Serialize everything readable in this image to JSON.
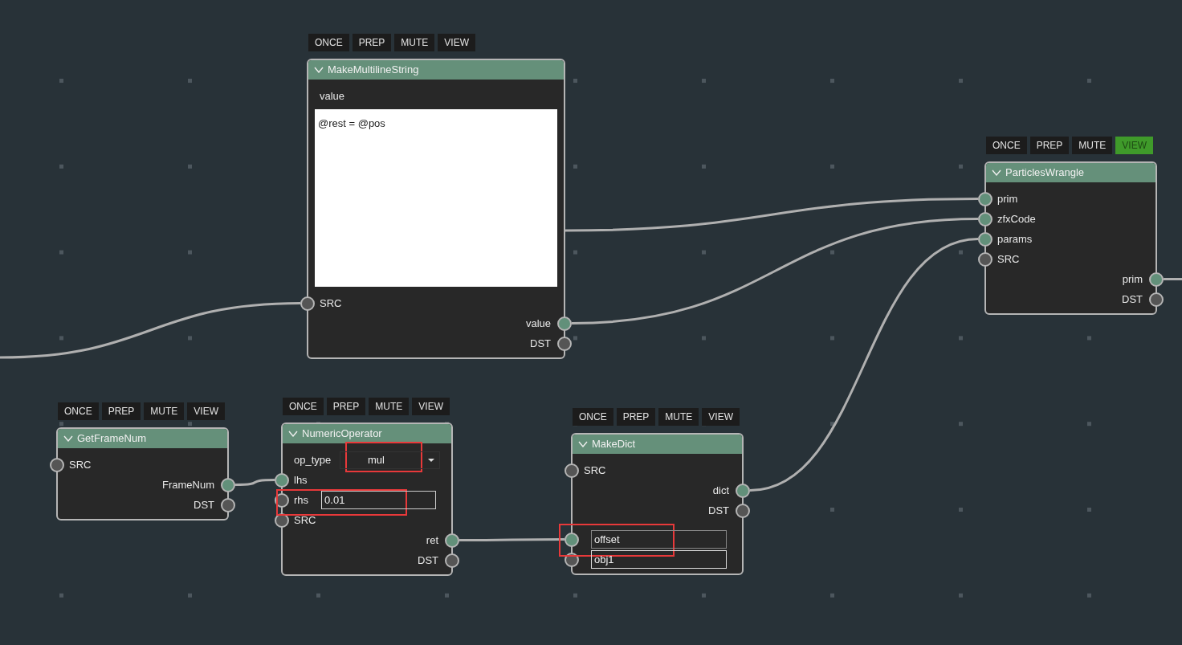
{
  "nodes": [
    {
      "title": "MakeMultilineString",
      "flags": [
        {
          "label": "ONCE",
          "on": false
        },
        {
          "label": "PREP",
          "on": false
        },
        {
          "label": "MUTE",
          "on": false
        },
        {
          "label": "VIEW",
          "on": false
        }
      ],
      "rows": [
        {
          "kind": "label",
          "label": "value"
        },
        {
          "kind": "textarea",
          "value": "@rest = @pos"
        },
        {
          "kind": "input",
          "label": "SRC",
          "color": "#555555"
        },
        {
          "kind": "output",
          "label": "value",
          "color": "#62907a"
        },
        {
          "kind": "output",
          "label": "DST",
          "color": "#555555"
        }
      ]
    },
    {
      "title": "ParticlesWrangle",
      "flags": [
        {
          "label": "ONCE",
          "on": false
        },
        {
          "label": "PREP",
          "on": false
        },
        {
          "label": "MUTE",
          "on": false
        },
        {
          "label": "VIEW",
          "on": true
        }
      ],
      "rows": [
        {
          "kind": "input",
          "label": "prim",
          "color": "#62907a"
        },
        {
          "kind": "input",
          "label": "zfxCode",
          "color": "#62907a"
        },
        {
          "kind": "input",
          "label": "params",
          "color": "#62907a"
        },
        {
          "kind": "input",
          "label": "SRC",
          "color": "#555555"
        },
        {
          "kind": "output",
          "label": "prim",
          "color": "#62907a"
        },
        {
          "kind": "output",
          "label": "DST",
          "color": "#555555"
        }
      ]
    },
    {
      "title": "GetFrameNum",
      "flags": [
        {
          "label": "ONCE",
          "on": false
        },
        {
          "label": "PREP",
          "on": false
        },
        {
          "label": "MUTE",
          "on": false
        },
        {
          "label": "VIEW",
          "on": false
        }
      ],
      "rows": [
        {
          "kind": "input",
          "label": "SRC",
          "color": "#555555"
        },
        {
          "kind": "output",
          "label": "FrameNum",
          "color": "#62907a"
        },
        {
          "kind": "output",
          "label": "DST",
          "color": "#555555"
        }
      ]
    },
    {
      "title": "NumericOperator",
      "flags": [
        {
          "label": "ONCE",
          "on": false
        },
        {
          "label": "PREP",
          "on": false
        },
        {
          "label": "MUTE",
          "on": false
        },
        {
          "label": "VIEW",
          "on": false
        }
      ],
      "rows": [
        {
          "kind": "select",
          "label": "op_type",
          "value": "mul",
          "highlighted": true
        },
        {
          "kind": "input",
          "label": "lhs",
          "color": "#62907a"
        },
        {
          "kind": "field",
          "label": "rhs",
          "value": "0.01",
          "color": "#555555",
          "highlighted": true
        },
        {
          "kind": "input",
          "label": "SRC",
          "color": "#555555"
        },
        {
          "kind": "output",
          "label": "ret",
          "color": "#62907a"
        },
        {
          "kind": "output",
          "label": "DST",
          "color": "#555555"
        }
      ]
    },
    {
      "title": "MakeDict",
      "flags": [
        {
          "label": "ONCE",
          "on": false
        },
        {
          "label": "PREP",
          "on": false
        },
        {
          "label": "MUTE",
          "on": false
        },
        {
          "label": "VIEW",
          "on": false
        }
      ],
      "rows": [
        {
          "kind": "input",
          "label": "SRC",
          "color": "#555555"
        },
        {
          "kind": "output",
          "label": "dict",
          "color": "#62907a"
        },
        {
          "kind": "output",
          "label": "DST",
          "color": "#555555"
        },
        {
          "kind": "entry",
          "value": "offset",
          "color": "#62907a",
          "highlighted": true
        },
        {
          "kind": "entry",
          "value": "obj1",
          "color": "#555555",
          "highlighted": false
        }
      ]
    }
  ]
}
